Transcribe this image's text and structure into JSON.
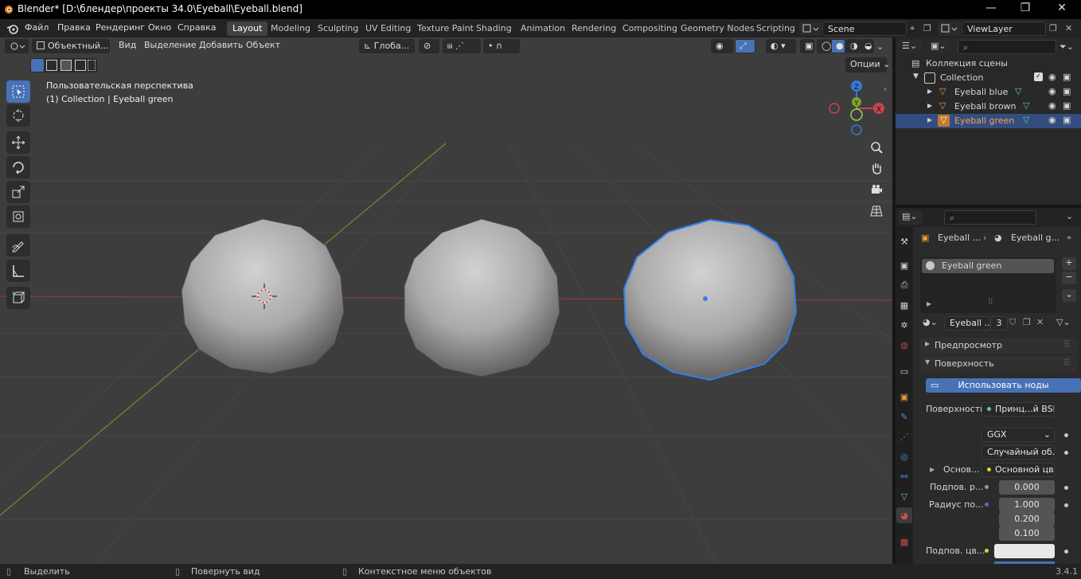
{
  "window": {
    "title": "Blender* [D:\\блендер\\проекты 34.0\\Eyeball\\Eyeball.blend]",
    "minimize": "—",
    "maximize": "❐",
    "close": "✕"
  },
  "menus": [
    "Файл",
    "Правка",
    "Рендеринг",
    "Окно",
    "Справка"
  ],
  "workspaces": [
    "Layout",
    "Modeling",
    "Sculpting",
    "UV Editing",
    "Texture Paint",
    "Shading",
    "Animation",
    "Rendering",
    "Compositing",
    "Geometry Nodes",
    "Scripting"
  ],
  "active_workspace": "Layout",
  "scene": {
    "name": "Scene"
  },
  "view_layer": {
    "name": "ViewLayer"
  },
  "viewport": {
    "mode": "Объектный...",
    "menus": [
      "Вид",
      "Выделение",
      "Добавить",
      "Объект"
    ],
    "transform_orientation": "Глоба...",
    "options_label": "Опции",
    "perspective_label": "Пользовательская перспектива",
    "collection_label": "(1) Collection | Eyeball green",
    "gizmo": {
      "z": "Z",
      "y": "Y",
      "x": "X"
    }
  },
  "outliner": {
    "root": "Коллекция сцены",
    "collection": "Collection",
    "objects": [
      {
        "name": "Eyeball blue",
        "selected": false
      },
      {
        "name": "Eyeball brown",
        "selected": false
      },
      {
        "name": "Eyeball green",
        "selected": true
      }
    ]
  },
  "properties": {
    "breadcrumb_object": "Eyeball ...",
    "breadcrumb_material": "Eyeball g...",
    "material_slot": "Eyeball green",
    "material_name": "Eyeball ...",
    "user_count": "3",
    "panels": {
      "preview": "Предпросмотр",
      "surface": "Поверхность"
    },
    "use_nodes_label": "Использовать ноды",
    "surface_label": "Поверхность",
    "surface_value": "Принц...й BSDF",
    "distribution": "GGX",
    "subsurface_method": "Случайный об...",
    "base_label": "Основ...",
    "base_value": "Основной цвет",
    "subsurface_label": "Подпов. р...",
    "subsurface_value": "0.000",
    "radius_label": "Радиус по...",
    "radius_values": [
      "1.000",
      "0.200",
      "0.100"
    ],
    "subsurface_color_label": "Подпов. цв..."
  },
  "status": {
    "select": "Выделить",
    "rotate": "Повернуть вид",
    "context": "Контекстное меню объектов",
    "version": "3.4.1"
  },
  "colors": {
    "accent": "#4872b6",
    "selection_outline": "#2f7ff0",
    "x_axis": "#c8434e",
    "y_axis": "#7aa329",
    "z_axis": "#3479d6",
    "orange_icon": "#e79a3c",
    "outliner_selected": "#334d80"
  }
}
